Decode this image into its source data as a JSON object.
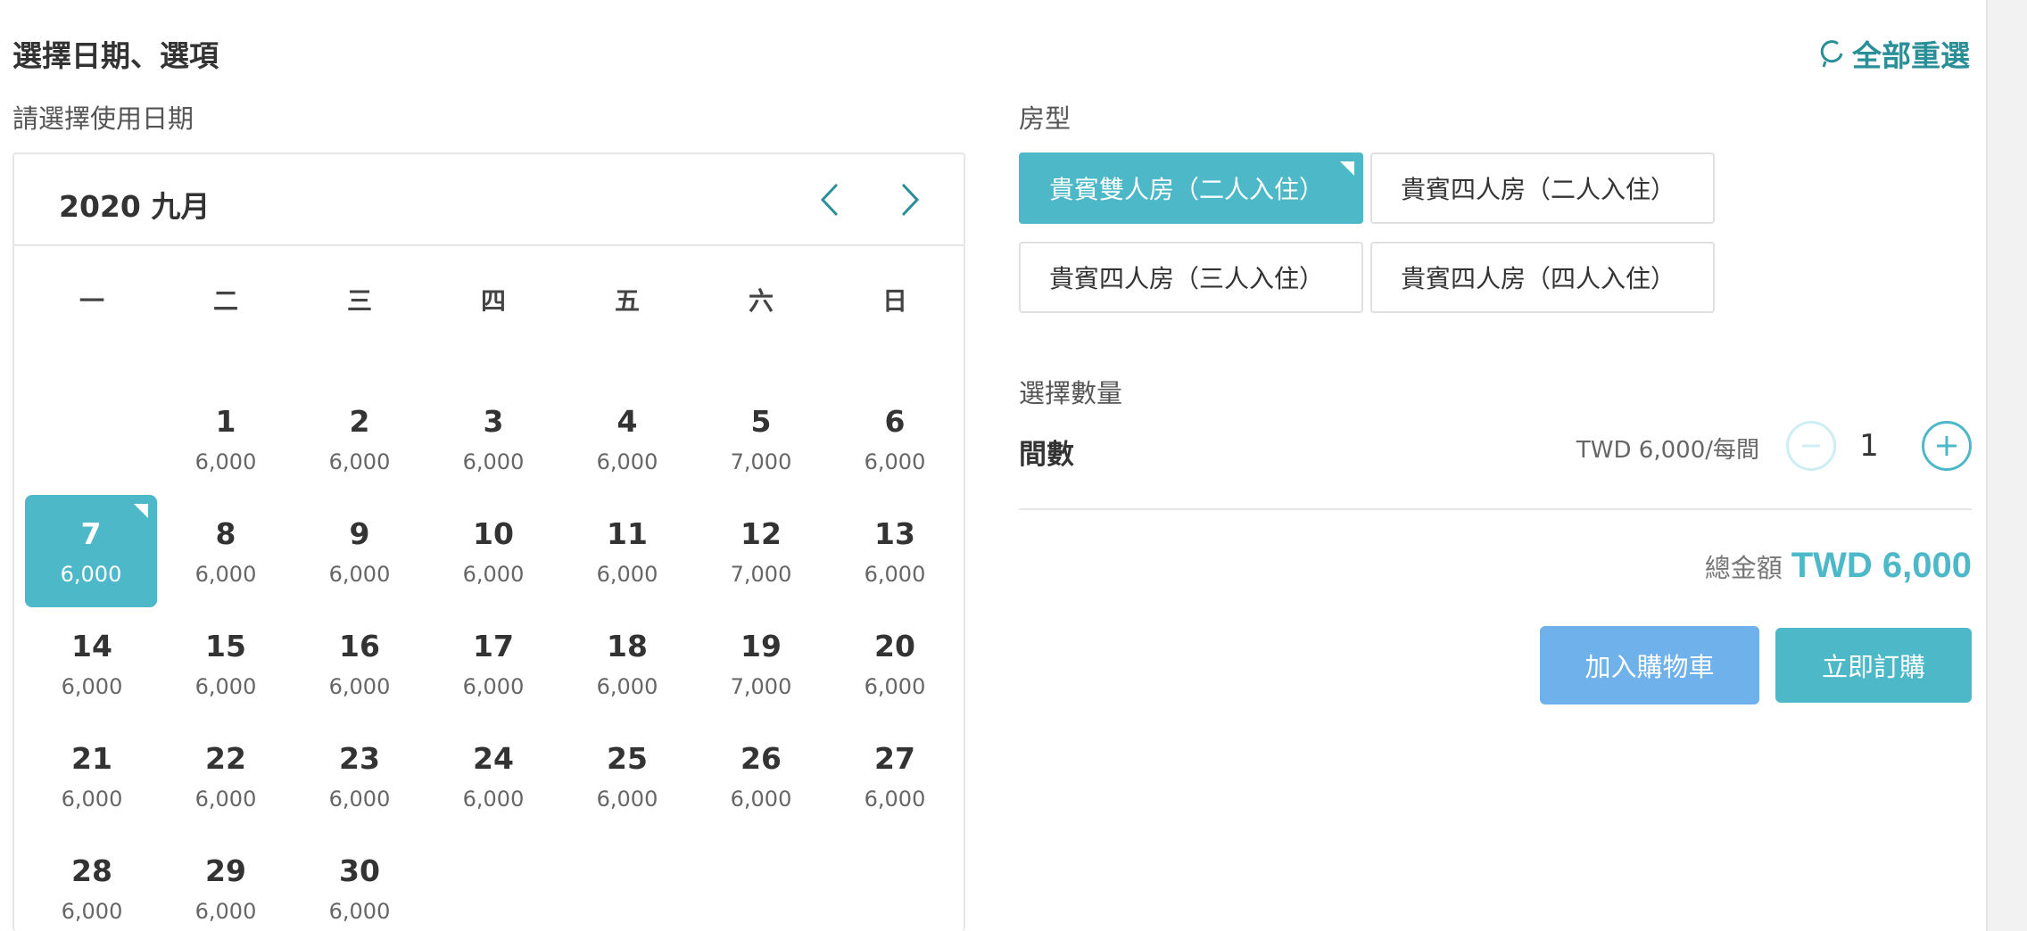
{
  "header": {
    "title": "選擇日期、選項",
    "reset_label": "全部重選"
  },
  "date_section": {
    "label": "請選擇使用日期",
    "month_title": "2020 九月",
    "weekdays": [
      "一",
      "二",
      "三",
      "四",
      "五",
      "六",
      "日"
    ],
    "selected_day": "7",
    "days": [
      {
        "num": "",
        "price": ""
      },
      {
        "num": "1",
        "price": "6,000"
      },
      {
        "num": "2",
        "price": "6,000"
      },
      {
        "num": "3",
        "price": "6,000"
      },
      {
        "num": "4",
        "price": "6,000"
      },
      {
        "num": "5",
        "price": "7,000"
      },
      {
        "num": "6",
        "price": "6,000"
      },
      {
        "num": "7",
        "price": "6,000"
      },
      {
        "num": "8",
        "price": "6,000"
      },
      {
        "num": "9",
        "price": "6,000"
      },
      {
        "num": "10",
        "price": "6,000"
      },
      {
        "num": "11",
        "price": "6,000"
      },
      {
        "num": "12",
        "price": "7,000"
      },
      {
        "num": "13",
        "price": "6,000"
      },
      {
        "num": "14",
        "price": "6,000"
      },
      {
        "num": "15",
        "price": "6,000"
      },
      {
        "num": "16",
        "price": "6,000"
      },
      {
        "num": "17",
        "price": "6,000"
      },
      {
        "num": "18",
        "price": "6,000"
      },
      {
        "num": "19",
        "price": "7,000"
      },
      {
        "num": "20",
        "price": "6,000"
      },
      {
        "num": "21",
        "price": "6,000"
      },
      {
        "num": "22",
        "price": "6,000"
      },
      {
        "num": "23",
        "price": "6,000"
      },
      {
        "num": "24",
        "price": "6,000"
      },
      {
        "num": "25",
        "price": "6,000"
      },
      {
        "num": "26",
        "price": "6,000"
      },
      {
        "num": "27",
        "price": "6,000"
      },
      {
        "num": "28",
        "price": "6,000"
      },
      {
        "num": "29",
        "price": "6,000"
      },
      {
        "num": "30",
        "price": "6,000"
      }
    ]
  },
  "room_section": {
    "label": "房型",
    "options": [
      {
        "label": "貴賓雙人房（二人入住）",
        "selected": true
      },
      {
        "label": "貴賓四人房（二人入住）",
        "selected": false
      },
      {
        "label": "貴賓四人房（三人入住）",
        "selected": false
      },
      {
        "label": "貴賓四人房（四人入住）",
        "selected": false
      }
    ]
  },
  "quantity_section": {
    "label": "選擇數量",
    "item_name": "間數",
    "unit_price": "TWD 6,000/每間",
    "value": "1"
  },
  "summary": {
    "total_label": "總金額",
    "total_value": "TWD 6,000"
  },
  "actions": {
    "add_to_cart": "加入購物車",
    "buy_now": "立即訂購"
  },
  "colors": {
    "accent": "#4db8c7",
    "accent_dark": "#2a8f97",
    "cart_button": "#6fb1ea"
  },
  "icons": {
    "reset": "refresh-icon",
    "prev": "chevron-left-icon",
    "next": "chevron-right-icon",
    "minus": "minus-icon",
    "plus": "plus-icon"
  }
}
